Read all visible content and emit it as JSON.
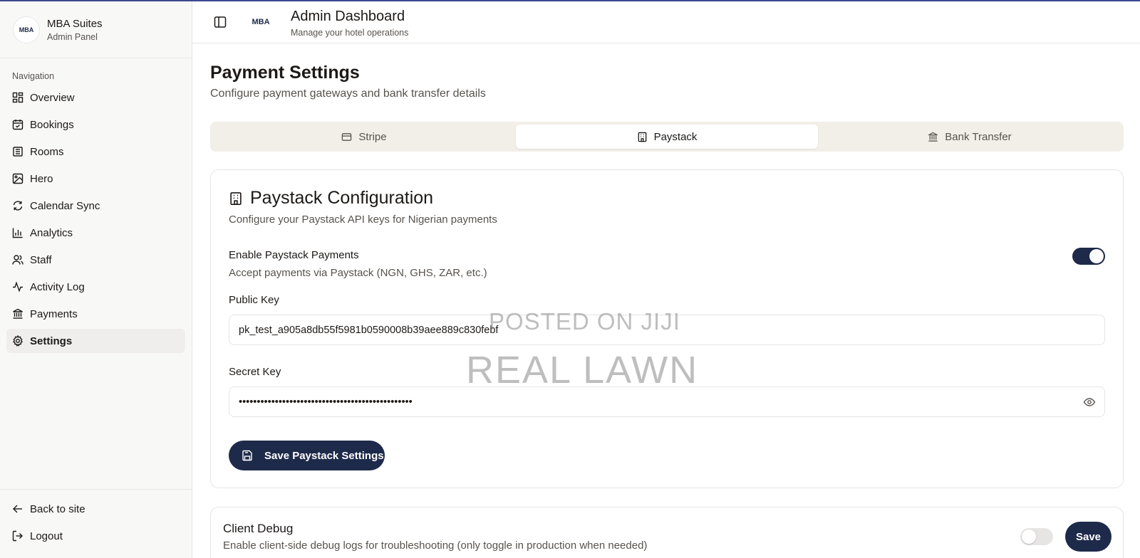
{
  "brand": {
    "name": "MBA Suites",
    "subtitle": "Admin Panel",
    "logo_text": "MBA"
  },
  "nav": {
    "heading": "Navigation",
    "items": [
      {
        "label": "Overview",
        "icon": "dashboard-icon"
      },
      {
        "label": "Bookings",
        "icon": "calendar-icon"
      },
      {
        "label": "Rooms",
        "icon": "bed-icon"
      },
      {
        "label": "Hero",
        "icon": "image-icon"
      },
      {
        "label": "Calendar Sync",
        "icon": "refresh-icon"
      },
      {
        "label": "Analytics",
        "icon": "bar-chart-icon"
      },
      {
        "label": "Staff",
        "icon": "users-icon"
      },
      {
        "label": "Activity Log",
        "icon": "activity-icon"
      },
      {
        "label": "Payments",
        "icon": "bank-icon"
      },
      {
        "label": "Settings",
        "icon": "gear-icon",
        "active": true
      }
    ],
    "footer": [
      {
        "label": "Back to site",
        "icon": "arrow-left-icon"
      },
      {
        "label": "Logout",
        "icon": "logout-icon"
      }
    ]
  },
  "header": {
    "logo_text": "MBA",
    "title": "Admin Dashboard",
    "subtitle": "Manage your hotel operations"
  },
  "page": {
    "title": "Payment Settings",
    "subtitle": "Configure payment gateways and bank transfer details"
  },
  "tabs": [
    {
      "label": "Stripe",
      "icon": "credit-card-icon"
    },
    {
      "label": "Paystack",
      "icon": "building-icon",
      "active": true
    },
    {
      "label": "Bank Transfer",
      "icon": "bank-icon"
    }
  ],
  "paystack": {
    "title": "Paystack Configuration",
    "subtitle": "Configure your Paystack API keys for Nigerian payments",
    "enable_label": "Enable Paystack Payments",
    "enable_desc": "Accept payments via Paystack (NGN, GHS, ZAR, etc.)",
    "enabled": true,
    "public_key_label": "Public Key",
    "public_key_value": "pk_test_a905a8db55f5981b0590008b39aee889c830febf",
    "secret_key_label": "Secret Key",
    "secret_key_value": "••••••••••••••••••••••••••••••••••••••••••••••••",
    "save_label": "Save Paystack Settings"
  },
  "debug": {
    "title": "Client Debug",
    "subtitle": "Enable client-side debug logs for troubleshooting (only toggle in production when needed)",
    "enabled": false,
    "save_label": "Save"
  },
  "watermark": {
    "line1": "POSTED ON JIJI",
    "line2": "REAL LAWN"
  },
  "colors": {
    "primary": "#1e2a4a",
    "tab_bg": "#f2efe9",
    "sidebar_bg": "#f8f8f7"
  }
}
